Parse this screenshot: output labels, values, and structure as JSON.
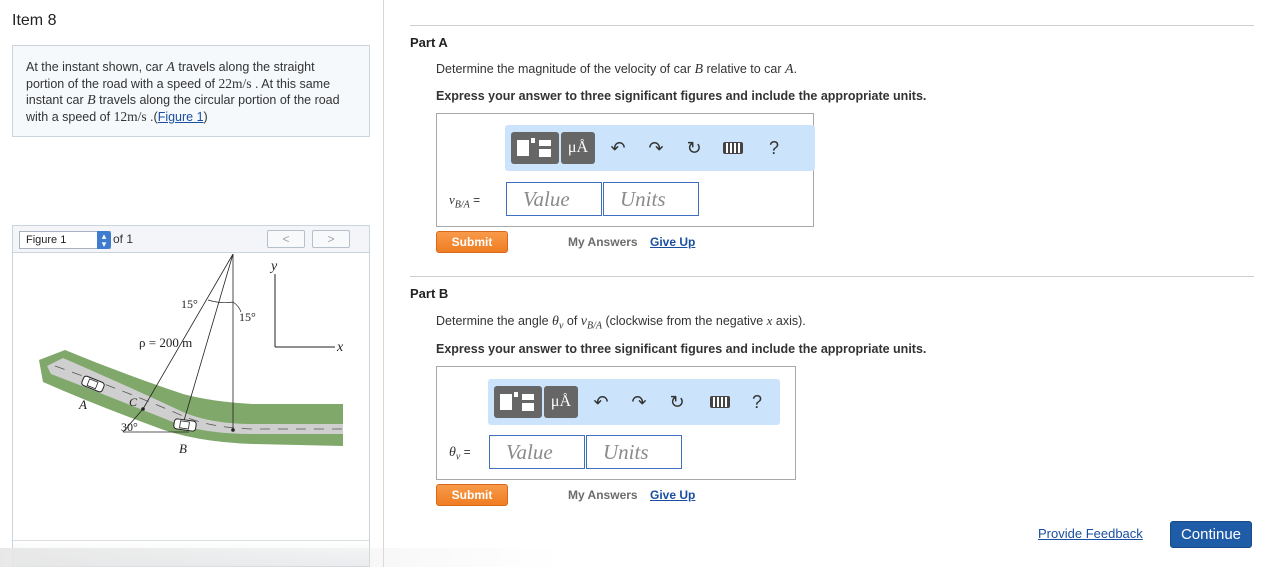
{
  "item": {
    "title": "Item 8"
  },
  "problem": {
    "text_1": "At the instant shown, car ",
    "car_a": "A",
    "text_2": " travels along the straight portion of the road with a speed of ",
    "speed_a": "22m/s",
    "text_3": " . At this same instant car ",
    "car_b": "B",
    "text_4": " travels along the circular portion of the road with a speed of ",
    "speed_b": "12m/s",
    "text_5": " .(",
    "figure_link": "Figure 1",
    "text_6": ")"
  },
  "figure_panel": {
    "select_value": "Figure 1",
    "of_label": "of 1",
    "prev_icon": "chevron-left-icon",
    "next_icon": "chevron-right-icon",
    "labels": {
      "y_axis": "y",
      "x_axis": "x",
      "angle_left": "15°",
      "angle_right": "15°",
      "radius": "ρ = 200 m",
      "car_a": "A",
      "car_b": "B",
      "point_c": "C",
      "angle_bottom": "30°"
    }
  },
  "part_a": {
    "title": "Part A",
    "prompt_1": "Determine the magnitude of the velocity of car ",
    "prompt_car_b": "B",
    "prompt_2": " relative to car ",
    "prompt_car_a": "A",
    "prompt_3": ".",
    "instruction": "Express your answer to three significant figures and include the appropriate units.",
    "var_symbol": "v",
    "var_sub": "B/A",
    "var_eq": " =",
    "value_placeholder": "Value",
    "units_placeholder": "Units",
    "submit": "Submit",
    "my_answers": "My Answers",
    "give_up": "Give Up"
  },
  "part_b": {
    "title": "Part B",
    "prompt_1": "Determine the angle ",
    "prompt_theta": "θ",
    "prompt_theta_sub": "v",
    "prompt_2": " of ",
    "prompt_v": "v",
    "prompt_v_sub": "B/A",
    "prompt_3": " (clockwise from the negative ",
    "prompt_x": "x",
    "prompt_4": " axis).",
    "instruction": "Express your answer to three significant figures and include the appropriate units.",
    "var_symbol": "θ",
    "var_sub": "v",
    "var_eq": " =",
    "value_placeholder": "Value",
    "units_placeholder": "Units",
    "submit": "Submit",
    "my_answers": "My Answers",
    "give_up": "Give Up"
  },
  "toolbar": {
    "templates_icon": "templates-icon",
    "units_label": "μÅ",
    "undo_icon": "undo-icon",
    "redo_icon": "redo-icon",
    "reset_icon": "reset-icon",
    "keyboard_icon": "keyboard-icon",
    "help_label": "?"
  },
  "footer": {
    "feedback": "Provide Feedback",
    "continue": "Continue"
  },
  "colors": {
    "accent_blue": "#1f5ca8",
    "submit_orange": "#ef7d22",
    "toolbar_bg": "#cce4fb",
    "road_green": "#7fa86a"
  }
}
